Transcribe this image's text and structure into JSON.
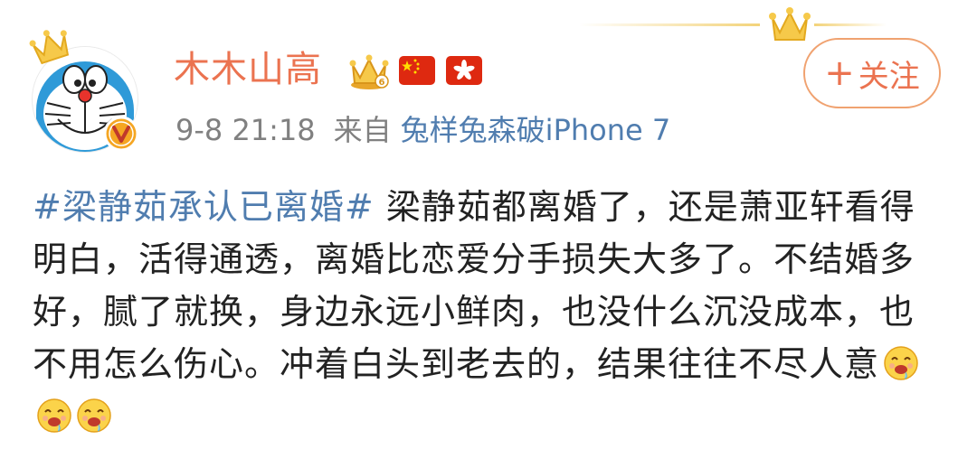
{
  "post": {
    "author": {
      "name": "木木山高",
      "avatar_icon": "doraemon-avatar",
      "badges": [
        "vip-crown-icon",
        "china-flag-icon",
        "hong-kong-flag-icon"
      ],
      "verified_icon": "verified-v-icon"
    },
    "follow_button": {
      "plus": "+",
      "label": "关注"
    },
    "meta": {
      "time": "9-8 21:18",
      "from_label": "来自",
      "source": "兔样兔森破iPhone 7"
    },
    "content": {
      "hashtag": "#梁静茹承认已离婚#",
      "text": " 梁静茹都离婚了，还是萧亚轩看得明白，活得通透，离婚比恋爱分手损失大多了。不结婚多好，腻了就换，身边永远小鲜肉，也没什么沉没成本，也不用怎么伤心。冲着白头到老去的，结果往往不尽人意",
      "emojis": [
        "drooling-face-emoji",
        "drooling-face-emoji",
        "drooling-face-emoji"
      ]
    }
  },
  "colors": {
    "name": "#eb7350",
    "link": "#507daf",
    "meta": "#808080",
    "button_border": "#f0a270"
  }
}
